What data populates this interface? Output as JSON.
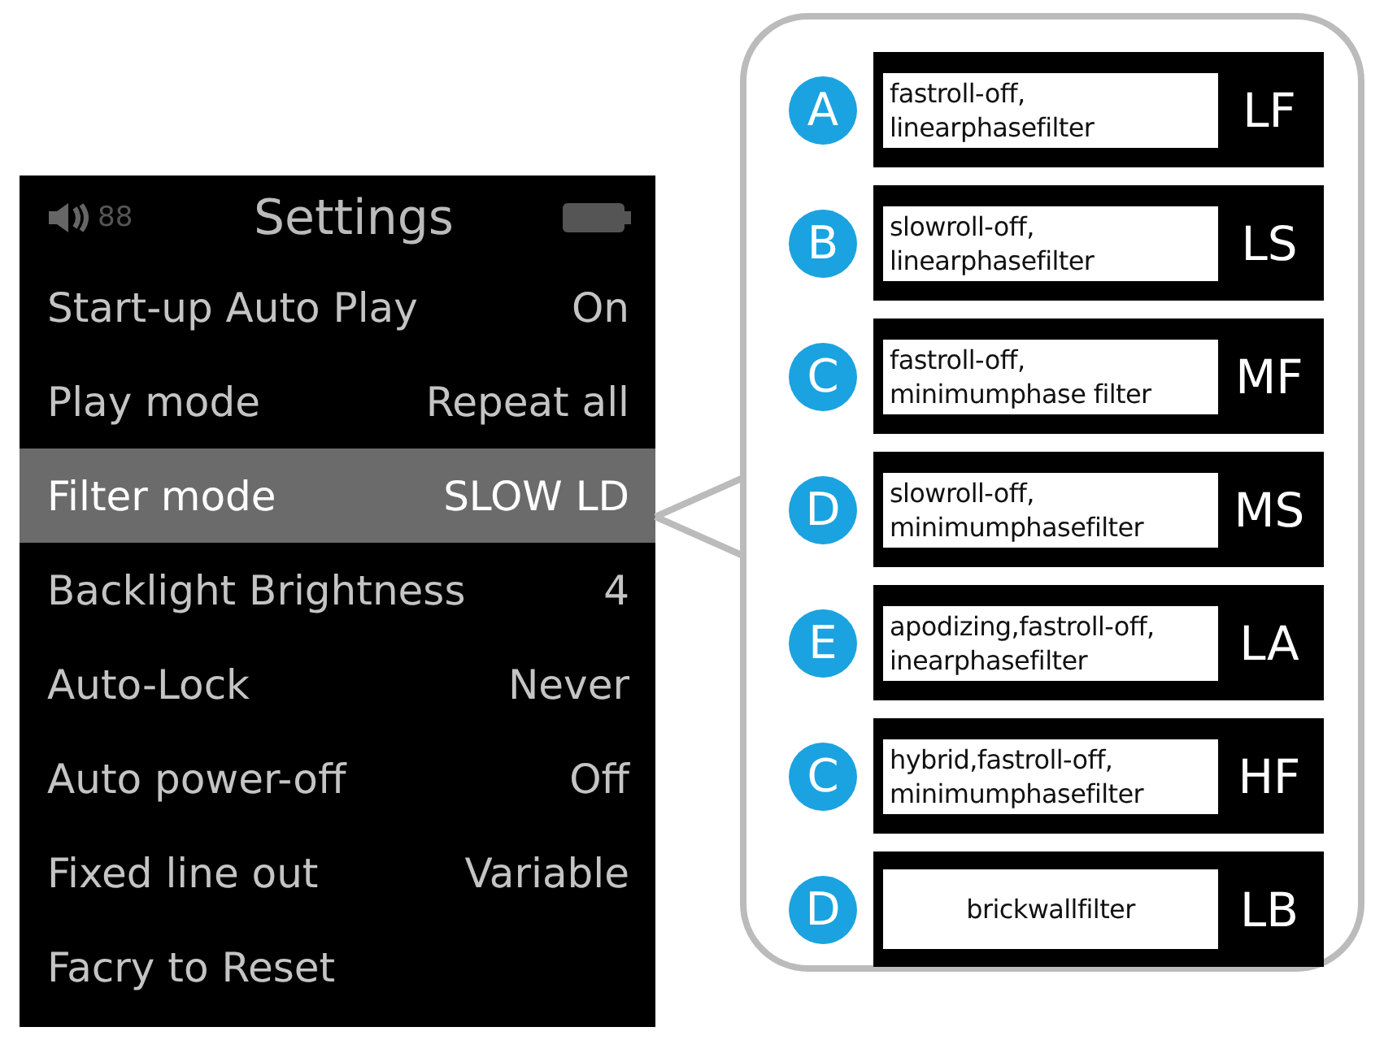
{
  "device": {
    "volume": "88",
    "title": "Settings",
    "rows": [
      {
        "label": "Start-up Auto Play",
        "value": "On",
        "selected": false
      },
      {
        "label": "Play mode",
        "value": "Repeat all",
        "selected": false
      },
      {
        "label": "Filter mode",
        "value": "SLOW LD",
        "selected": true
      },
      {
        "label": "Backlight Brightness",
        "value": "4",
        "selected": false
      },
      {
        "label": "Auto-Lock",
        "value": "Never",
        "selected": false
      },
      {
        "label": "Auto power-off",
        "value": "Off",
        "selected": false
      },
      {
        "label": "Fixed line out",
        "value": "Variable",
        "selected": false
      },
      {
        "label": "Facry to Reset",
        "selected": false
      }
    ]
  },
  "filters": [
    {
      "letter": "A",
      "lines": [
        "fastroll-off,",
        "linearphasefilter"
      ],
      "code": "LF"
    },
    {
      "letter": "B",
      "lines": [
        "slowroll-off,",
        "linearphasefilter"
      ],
      "code": "LS"
    },
    {
      "letter": "C",
      "lines": [
        "fastroll-off,",
        "minimumphase filter"
      ],
      "code": "MF"
    },
    {
      "letter": "D",
      "lines": [
        "slowroll-off,",
        "minimumphasefilter"
      ],
      "code": "MS"
    },
    {
      "letter": "E",
      "lines": [
        "apodizing,fastroll-off,",
        "inearphasefilter"
      ],
      "code": "LA"
    },
    {
      "letter": "C",
      "lines": [
        "hybrid,fastroll-off,",
        "minimumphasefilter"
      ],
      "code": "HF"
    },
    {
      "letter": "D",
      "lines": [
        "brickwallfilter"
      ],
      "code": "LB"
    }
  ]
}
